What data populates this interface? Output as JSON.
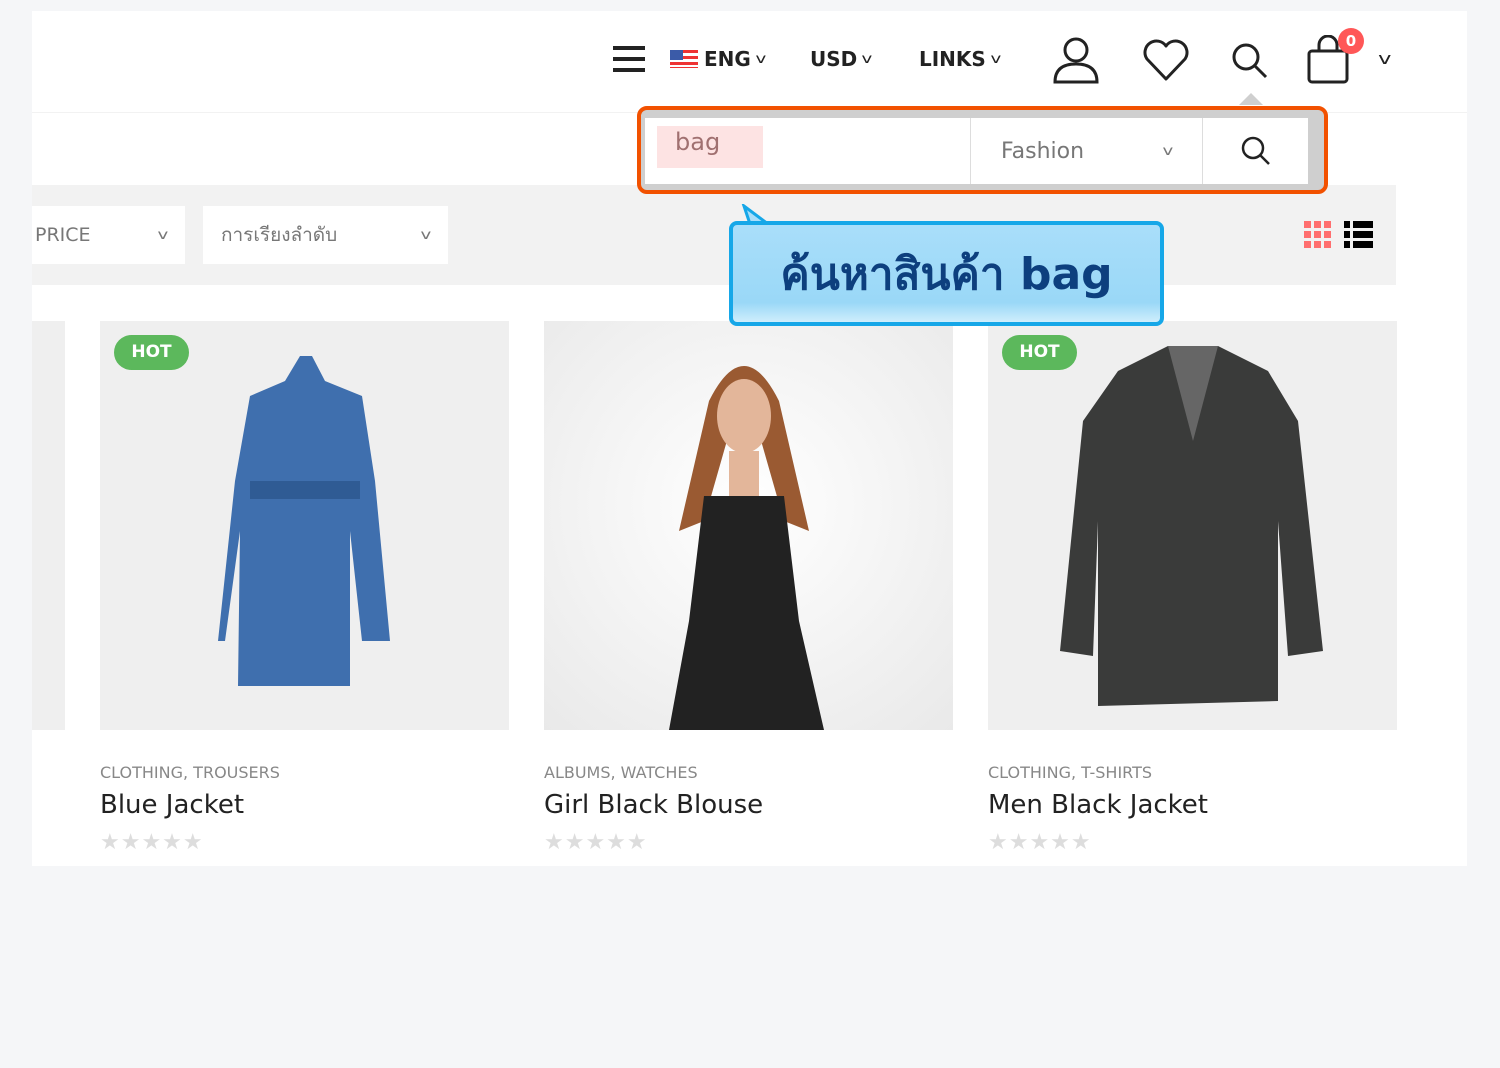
{
  "header": {
    "language": "ENG",
    "currency": "USD",
    "links": "LINKS",
    "cart_count": "0",
    "icons": [
      "menu-icon",
      "us-flag-icon",
      "user-icon",
      "heart-icon",
      "search-icon",
      "cart-icon"
    ]
  },
  "search": {
    "value": "bag",
    "category": "Fashion"
  },
  "callout": {
    "text": "ค้นหาสินค้า bag"
  },
  "filters": {
    "price": "PRICE",
    "sort": "การเรียงลำดับ"
  },
  "colors": {
    "accent": "#f25100",
    "callout_border": "#16a7e8",
    "hot": "#5cb85c",
    "badge": "#ff5757"
  },
  "products": [
    {
      "badge": "HOT",
      "categories": "CLOTHING, TROUSERS",
      "name": "Blue Jacket",
      "rating": 0
    },
    {
      "badge": "",
      "categories": "ALBUMS, WATCHES",
      "name": "Girl Black Blouse",
      "rating": 0
    },
    {
      "badge": "HOT",
      "categories": "CLOTHING, T-SHIRTS",
      "name": "Men Black Jacket",
      "rating": 0
    }
  ]
}
